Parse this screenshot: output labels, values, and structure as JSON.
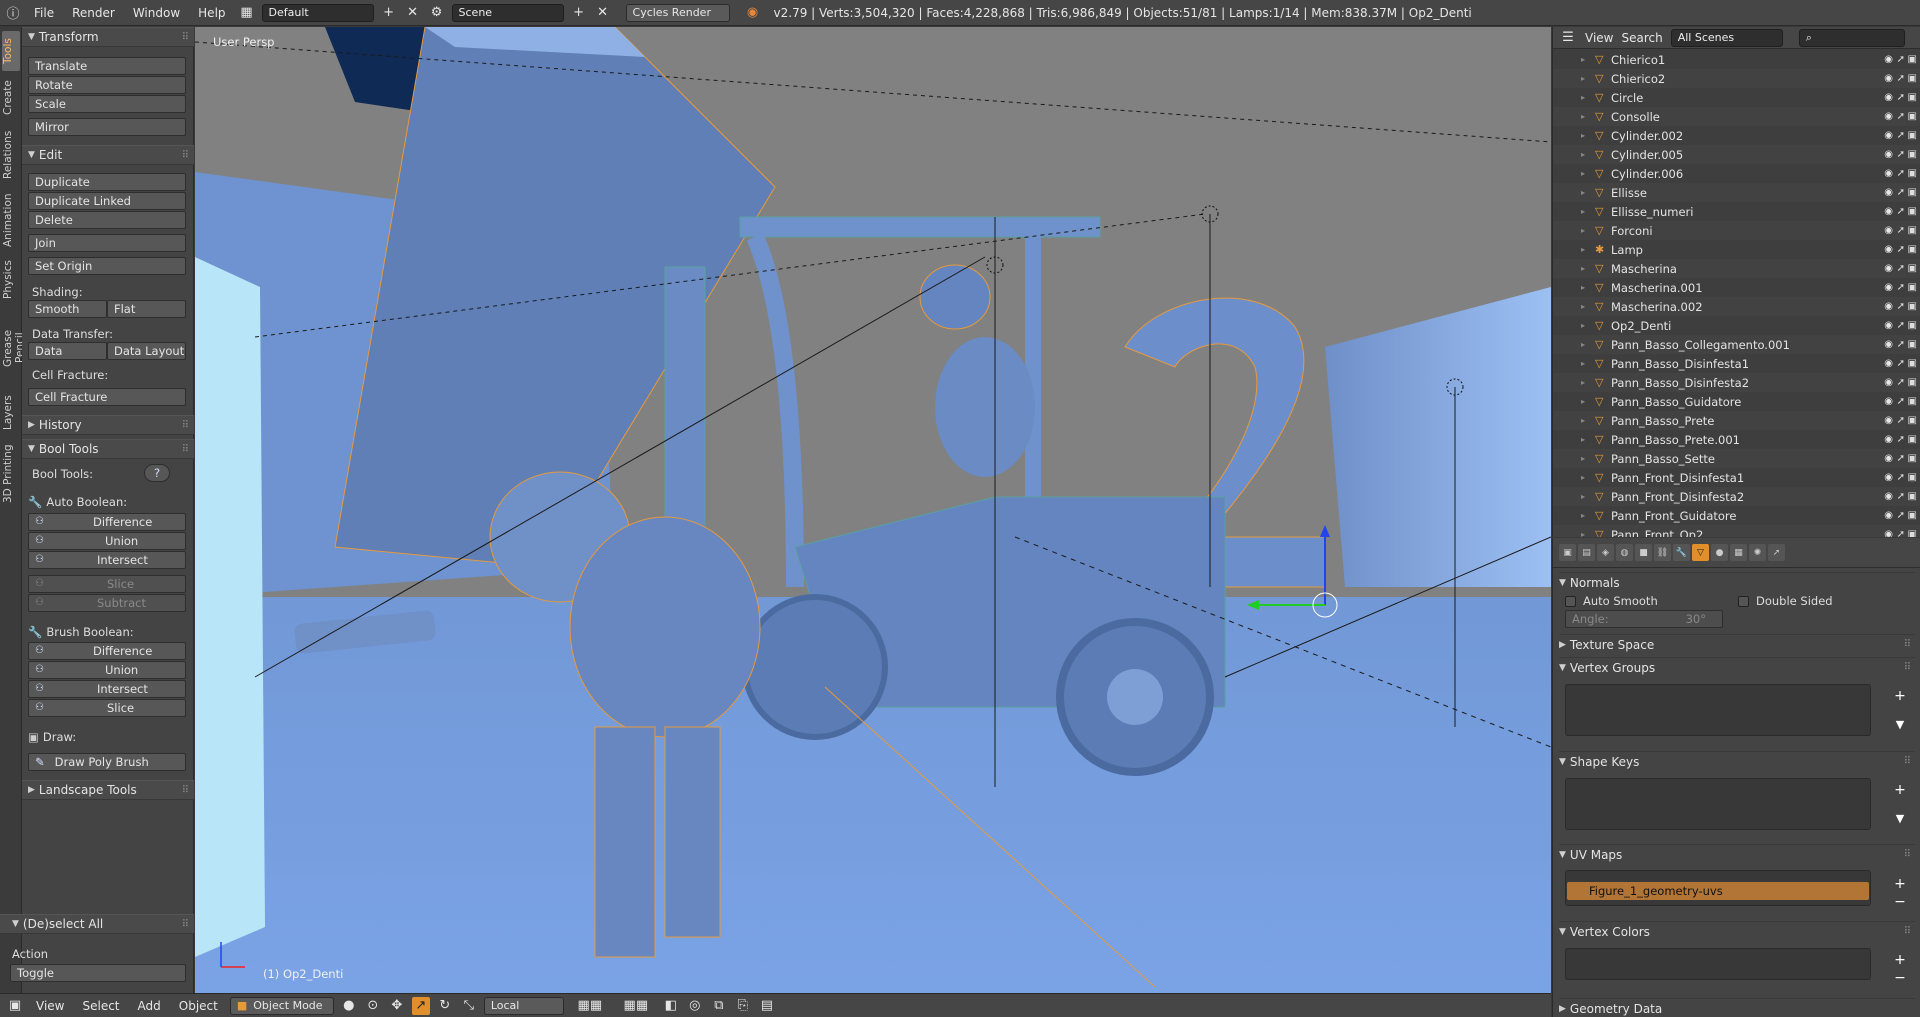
{
  "topbar": {
    "menus": [
      "File",
      "Render",
      "Window",
      "Help"
    ],
    "layout": "Default",
    "scene": "Scene",
    "engine": "Cycles Render",
    "stats": "v2.79 | Verts:3,504,320 | Faces:4,228,868 | Tris:6,986,849 | Objects:51/81 | Lamps:1/14 | Mem:838.37M | Op2_Denti"
  },
  "vtabs": [
    "Tools",
    "Create",
    "Relations",
    "Animation",
    "Physics",
    "Grease Pencil",
    "Layers",
    "3D Printing"
  ],
  "tools": {
    "transform": {
      "title": "Transform",
      "buttons": [
        "Translate",
        "Rotate",
        "Scale",
        "Mirror"
      ]
    },
    "edit": {
      "title": "Edit",
      "buttons": [
        "Duplicate",
        "Duplicate Linked",
        "Delete",
        "Join",
        "Set Origin"
      ]
    },
    "shading": {
      "label": "Shading:",
      "smooth": "Smooth",
      "flat": "Flat"
    },
    "data_transfer": {
      "label": "Data Transfer:",
      "data": "Data",
      "layout": "Data Layout"
    },
    "cell_fracture": {
      "label": "Cell Fracture:",
      "button": "Cell Fracture"
    },
    "history": "History",
    "bool_tools": {
      "title": "Bool Tools",
      "label": "Bool Tools:",
      "help": "?",
      "auto_label": "Auto Boolean:",
      "auto": [
        "Difference",
        "Union",
        "Intersect"
      ],
      "auto_disabled": [
        "Slice",
        "Subtract"
      ],
      "brush_label": "Brush Boolean:",
      "brush": [
        "Difference",
        "Union",
        "Intersect",
        "Slice"
      ],
      "draw_label": "Draw:",
      "draw_button": "Draw Poly Brush"
    },
    "landscape": "Landscape Tools",
    "deselect": {
      "title": "(De)select All",
      "action_label": "Action",
      "action_value": "Toggle"
    }
  },
  "viewport": {
    "title": "User Persp",
    "object": "(1) Op2_Denti"
  },
  "bottombar": {
    "menus": [
      "View",
      "Select",
      "Add",
      "Object"
    ],
    "mode": "Object Mode",
    "orientation": "Local"
  },
  "outliner": {
    "menus": [
      "View",
      "Search"
    ],
    "scenes": "All Scenes",
    "items": [
      {
        "name": "Chierico1",
        "icon": "mesh"
      },
      {
        "name": "Chierico2",
        "icon": "mesh"
      },
      {
        "name": "Circle",
        "icon": "mesh"
      },
      {
        "name": "Consolle",
        "icon": "mesh"
      },
      {
        "name": "Cylinder.002",
        "icon": "mesh"
      },
      {
        "name": "Cylinder.005",
        "icon": "mesh"
      },
      {
        "name": "Cylinder.006",
        "icon": "mesh"
      },
      {
        "name": "Ellisse",
        "icon": "mesh"
      },
      {
        "name": "Ellisse_numeri",
        "icon": "mesh"
      },
      {
        "name": "Forconi",
        "icon": "mesh"
      },
      {
        "name": "Lamp",
        "icon": "lamp"
      },
      {
        "name": "Mascherina",
        "icon": "mesh"
      },
      {
        "name": "Mascherina.001",
        "icon": "mesh"
      },
      {
        "name": "Mascherina.002",
        "icon": "mesh"
      },
      {
        "name": "Op2_Denti",
        "icon": "mesh"
      },
      {
        "name": "Pann_Basso_Collegamento.001",
        "icon": "mesh"
      },
      {
        "name": "Pann_Basso_Disinfesta1",
        "icon": "mesh"
      },
      {
        "name": "Pann_Basso_Disinfesta2",
        "icon": "mesh"
      },
      {
        "name": "Pann_Basso_Guidatore",
        "icon": "mesh"
      },
      {
        "name": "Pann_Basso_Prete",
        "icon": "mesh"
      },
      {
        "name": "Pann_Basso_Prete.001",
        "icon": "mesh"
      },
      {
        "name": "Pann_Basso_Sette",
        "icon": "mesh"
      },
      {
        "name": "Pann_Front_Disinfesta1",
        "icon": "mesh"
      },
      {
        "name": "Pann_Front_Disinfesta2",
        "icon": "mesh"
      },
      {
        "name": "Pann_Front_Guidatore",
        "icon": "mesh"
      },
      {
        "name": "Pann_Front_Op2",
        "icon": "mesh"
      }
    ]
  },
  "props": {
    "normals": {
      "title": "Normals",
      "auto_smooth": "Auto Smooth",
      "double_sided": "Double Sided",
      "angle_label": "Angle:",
      "angle_value": "30°"
    },
    "texture_space": "Texture Space",
    "vertex_groups": "Vertex Groups",
    "shape_keys": "Shape Keys",
    "uv_maps": {
      "title": "UV Maps",
      "item": "Figure_1_geometry-uvs"
    },
    "vertex_colors": "Vertex Colors",
    "geometry_data": "Geometry Data"
  },
  "colors": {
    "accent": "#e08f2b",
    "scene_blue": "#7aa0d8",
    "selection_orange": "#e59a3c"
  }
}
